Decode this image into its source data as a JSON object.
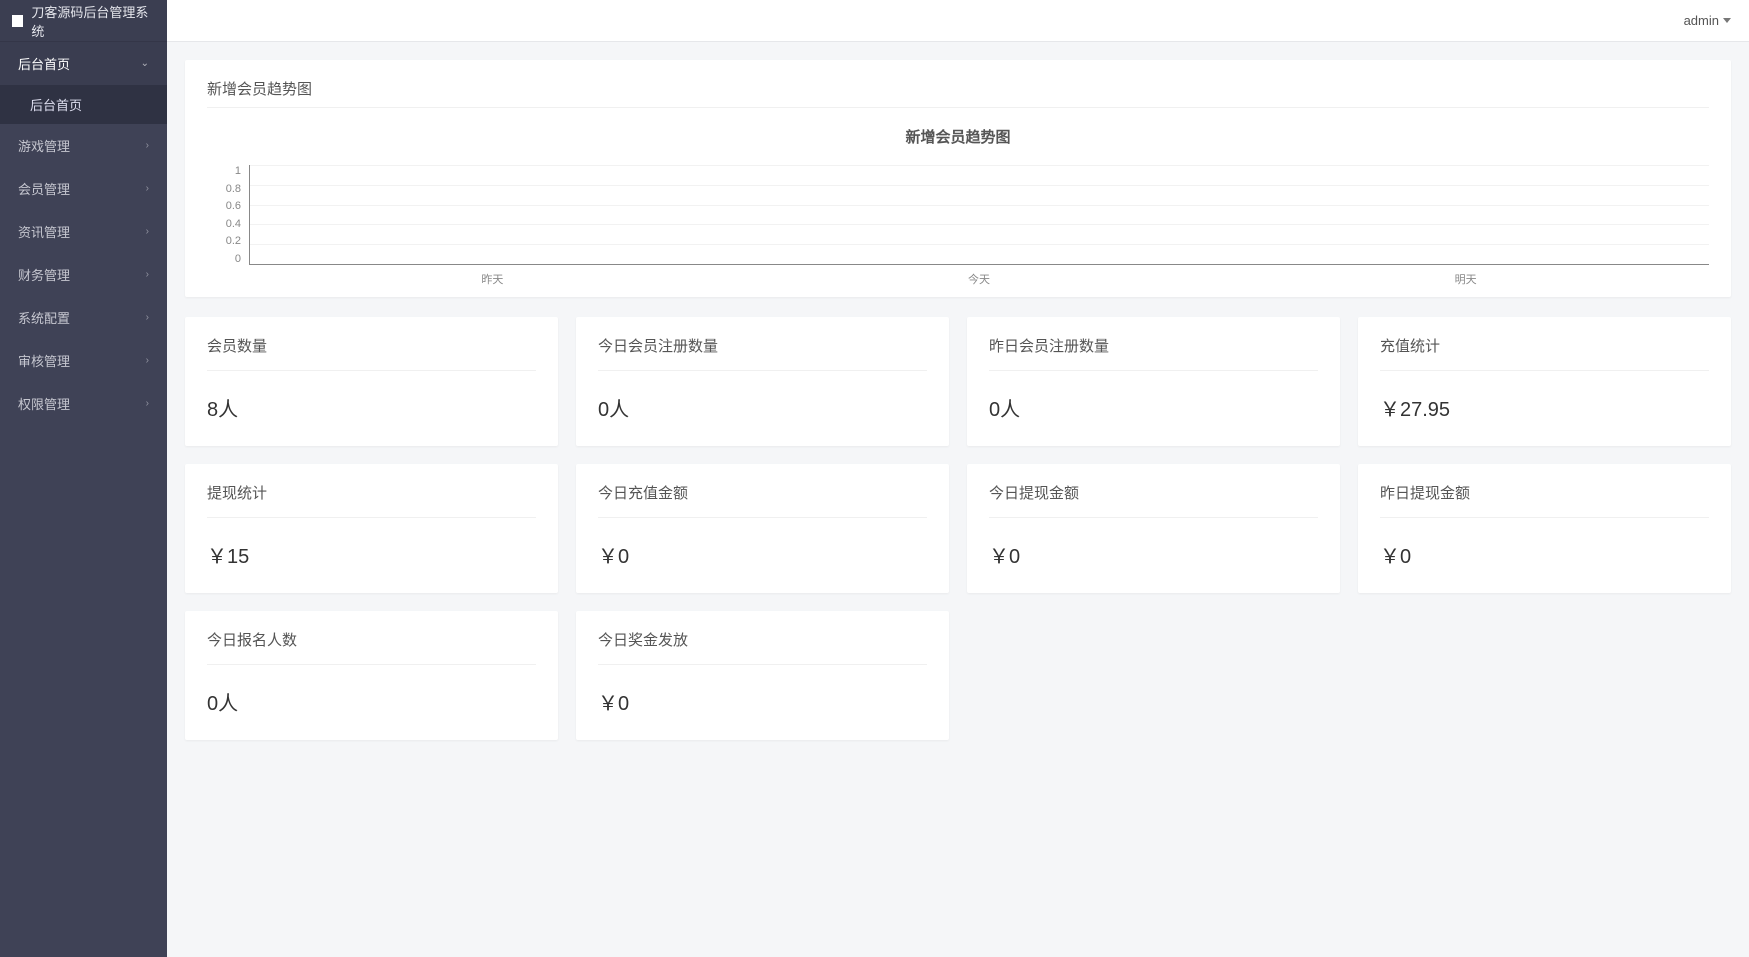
{
  "brand": "刀客源码后台管理系统",
  "user": {
    "name": "admin"
  },
  "sidebar": {
    "items": [
      {
        "label": "后台首页",
        "expanded": true,
        "children": [
          {
            "label": "后台首页"
          }
        ]
      },
      {
        "label": "游戏管理"
      },
      {
        "label": "会员管理"
      },
      {
        "label": "资讯管理"
      },
      {
        "label": "财务管理"
      },
      {
        "label": "系统配置"
      },
      {
        "label": "审核管理"
      },
      {
        "label": "权限管理"
      }
    ]
  },
  "chart_data": {
    "type": "line",
    "header": "新增会员趋势图",
    "title": "新增会员趋势图",
    "categories": [
      "昨天",
      "今天",
      "明天"
    ],
    "values": [
      0,
      0,
      0
    ],
    "ylim": [
      0,
      1
    ],
    "yticks": [
      "1",
      "0.8",
      "0.6",
      "0.4",
      "0.2",
      "0"
    ]
  },
  "stats": [
    {
      "label": "会员数量",
      "value": "8人"
    },
    {
      "label": "今日会员注册数量",
      "value": "0人"
    },
    {
      "label": "昨日会员注册数量",
      "value": "0人"
    },
    {
      "label": "充值统计",
      "value": "￥27.95"
    },
    {
      "label": "提现统计",
      "value": "￥15"
    },
    {
      "label": "今日充值金额",
      "value": "￥0"
    },
    {
      "label": "今日提现金额",
      "value": "￥0"
    },
    {
      "label": "昨日提现金额",
      "value": "￥0"
    },
    {
      "label": "今日报名人数",
      "value": "0人"
    },
    {
      "label": "今日奖金发放",
      "value": "￥0"
    }
  ]
}
